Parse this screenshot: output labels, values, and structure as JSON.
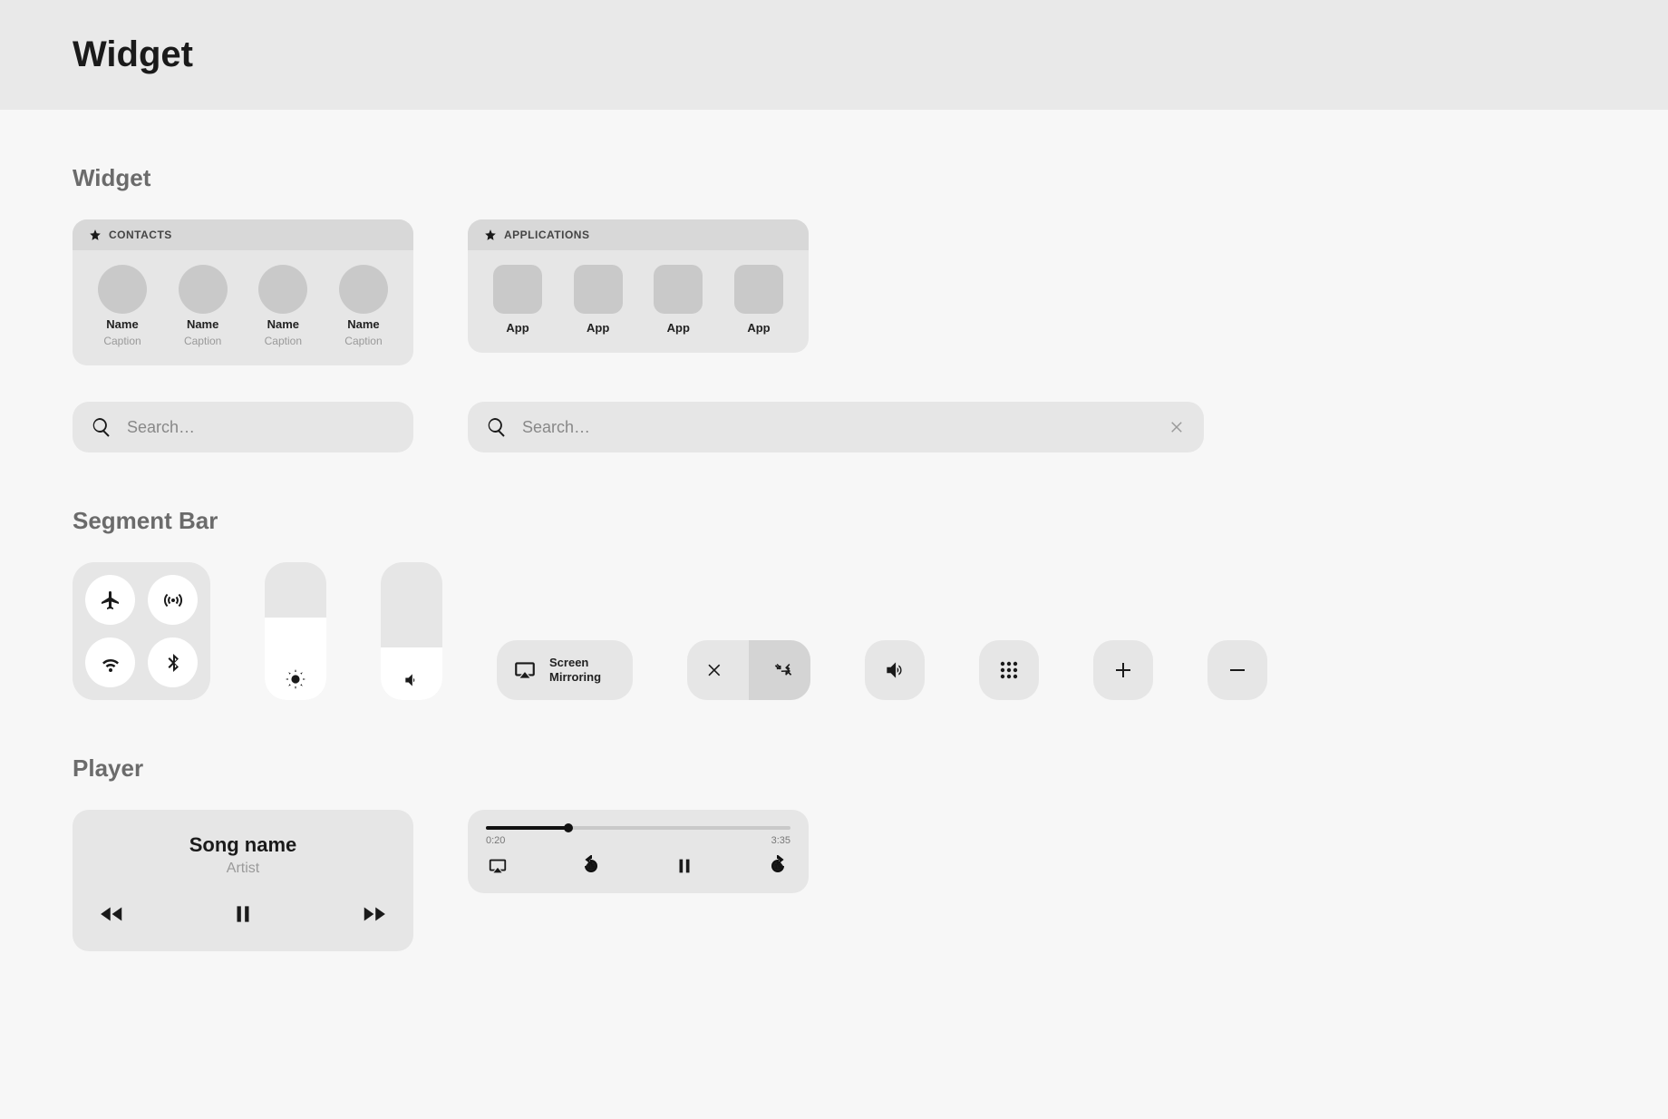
{
  "header": {
    "title": "Widget"
  },
  "sections": {
    "widget": "Widget",
    "segment": "Segment Bar",
    "player": "Player"
  },
  "contacts_card": {
    "title": "CONTACTS",
    "items": [
      {
        "name": "Name",
        "caption": "Caption"
      },
      {
        "name": "Name",
        "caption": "Caption"
      },
      {
        "name": "Name",
        "caption": "Caption"
      },
      {
        "name": "Name",
        "caption": "Caption"
      }
    ]
  },
  "apps_card": {
    "title": "APPLICATIONS",
    "items": [
      {
        "label": "App"
      },
      {
        "label": "App"
      },
      {
        "label": "App"
      },
      {
        "label": "App"
      }
    ]
  },
  "search": {
    "placeholder": "Search…"
  },
  "segment": {
    "brightness_fill_pct": 60,
    "volume_fill_pct": 38,
    "screen_mirroring_line1": "Screen",
    "screen_mirroring_line2": "Mirroring"
  },
  "player1": {
    "song": "Song name",
    "artist": "Artist"
  },
  "player2": {
    "elapsed": "0:20",
    "total": "3:35",
    "progress_pct": 27
  }
}
